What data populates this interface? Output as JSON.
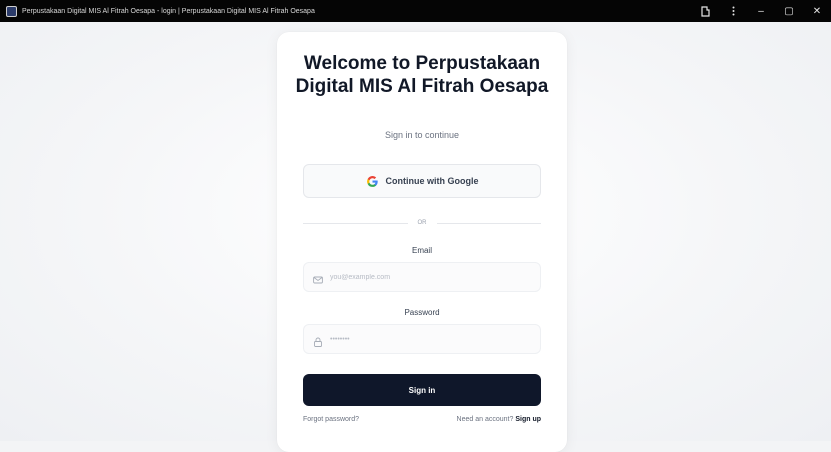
{
  "window": {
    "title": "Perpustakaan Digital MIS Al Fitrah Oesapa - login | Perpustakaan Digital MIS Al Fitrah Oesapa",
    "controls": {
      "minimize": "–",
      "maximize": "▢",
      "close": "✕"
    }
  },
  "card": {
    "heading": "Welcome to Perpustakaan Digital MIS Al Fitrah Oesapa",
    "subtitle": "Sign in to continue",
    "google_button": "Continue with Google",
    "divider": "OR",
    "email": {
      "label": "Email",
      "placeholder": "you@example.com"
    },
    "password": {
      "label": "Password",
      "placeholder": "••••••••"
    },
    "signin_button": "Sign in",
    "forgot_password": "Forgot password?",
    "need_account": "Need an account?",
    "signup": "Sign up"
  },
  "colors": {
    "primary_button": "#0f172a",
    "background": "#f3f4f6",
    "titlebar": "#050505"
  },
  "icons": [
    "app-icon",
    "extension-icon",
    "menu-dots-icon",
    "minimize-icon",
    "maximize-icon",
    "close-icon",
    "google-icon",
    "mail-icon",
    "lock-icon"
  ]
}
